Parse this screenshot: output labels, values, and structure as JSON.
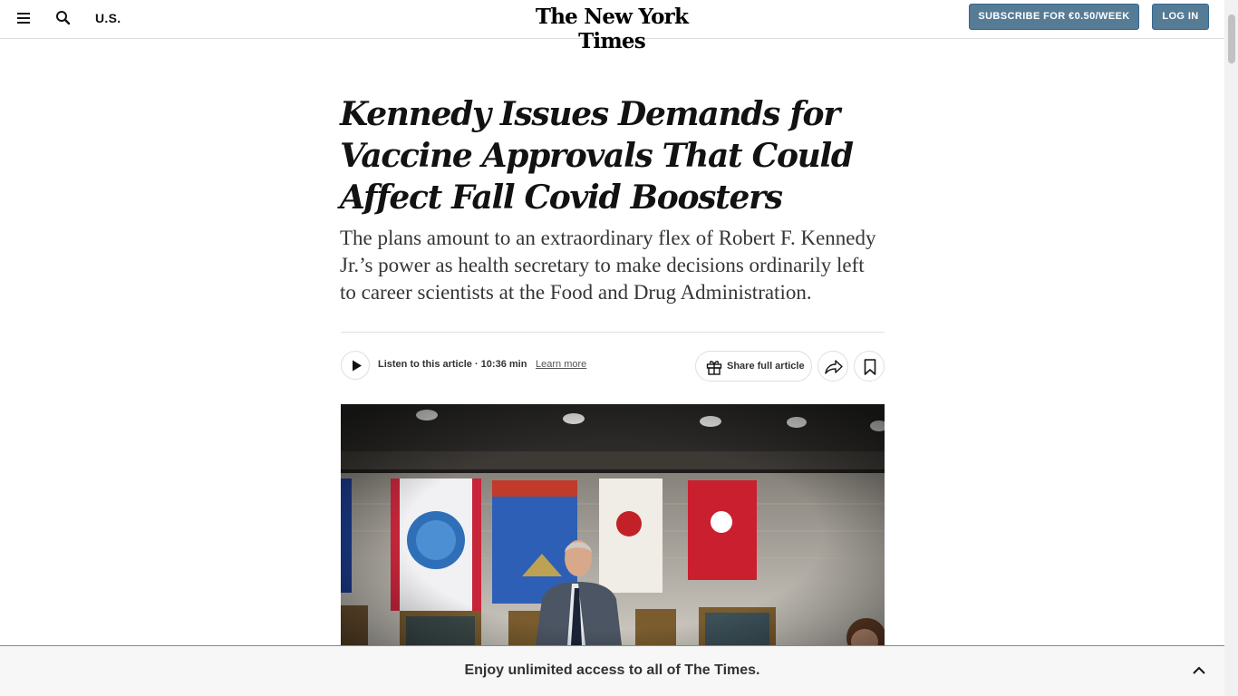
{
  "header": {
    "section": "U.S.",
    "masthead": "The New York Times",
    "subscribe_label": "SUBSCRIBE FOR €0.50/WEEK",
    "login_label": "LOG IN"
  },
  "article": {
    "headline": "Kennedy Issues Demands for Vaccine Approvals That Could Affect Fall Covid Boosters",
    "summary": "The plans amount to an extraordinary flex of Robert F. Kennedy Jr.’s power as health secretary to make decisions ordinarily left to career scientists at the Food and Drug Administration.",
    "listen_text": "Listen to this article · 10:36 min",
    "learn_more": "Learn more",
    "share_full_label": "Share full article"
  },
  "footer_bar": {
    "text": "Enjoy unlimited access to all of The Times."
  },
  "icons": {
    "menu": "hamburger-menu-icon",
    "search": "search-icon",
    "play": "play-icon",
    "gift": "gift-icon",
    "share": "share-arrow-icon",
    "bookmark": "bookmark-icon",
    "collapse": "chevron-up-icon"
  },
  "colors": {
    "button_bg": "#567b95",
    "text": "#121212",
    "divider": "#dfdfdf"
  }
}
